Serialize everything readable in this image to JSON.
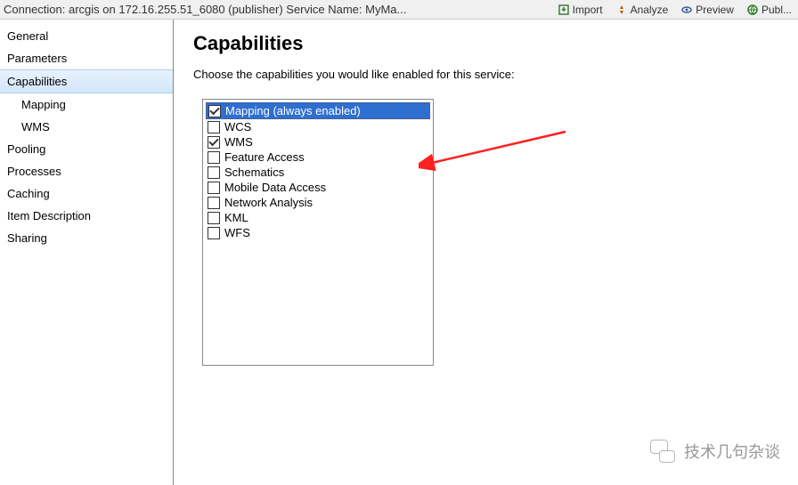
{
  "topbar": {
    "connection_text": "Connection: arcgis on 172.16.255.51_6080 (publisher)   Service Name: MyMa...",
    "buttons": {
      "import": "Import",
      "analyze": "Analyze",
      "preview": "Preview",
      "publish": "Publ..."
    }
  },
  "sidebar": {
    "items": [
      {
        "label": "General"
      },
      {
        "label": "Parameters"
      },
      {
        "label": "Capabilities"
      },
      {
        "label": "Mapping"
      },
      {
        "label": "WMS"
      },
      {
        "label": "Pooling"
      },
      {
        "label": "Processes"
      },
      {
        "label": "Caching"
      },
      {
        "label": "Item Description"
      },
      {
        "label": "Sharing"
      }
    ]
  },
  "content": {
    "heading": "Capabilities",
    "description": "Choose the capabilities you would like enabled for this service:",
    "capabilities": [
      {
        "label": "Mapping (always enabled)",
        "checked": true,
        "selected": true
      },
      {
        "label": "WCS",
        "checked": false
      },
      {
        "label": "WMS",
        "checked": true
      },
      {
        "label": "Feature Access",
        "checked": false
      },
      {
        "label": "Schematics",
        "checked": false
      },
      {
        "label": "Mobile Data Access",
        "checked": false
      },
      {
        "label": "Network Analysis",
        "checked": false
      },
      {
        "label": "KML",
        "checked": false
      },
      {
        "label": "WFS",
        "checked": false
      }
    ]
  },
  "watermark": {
    "text": "技术几句杂谈"
  }
}
